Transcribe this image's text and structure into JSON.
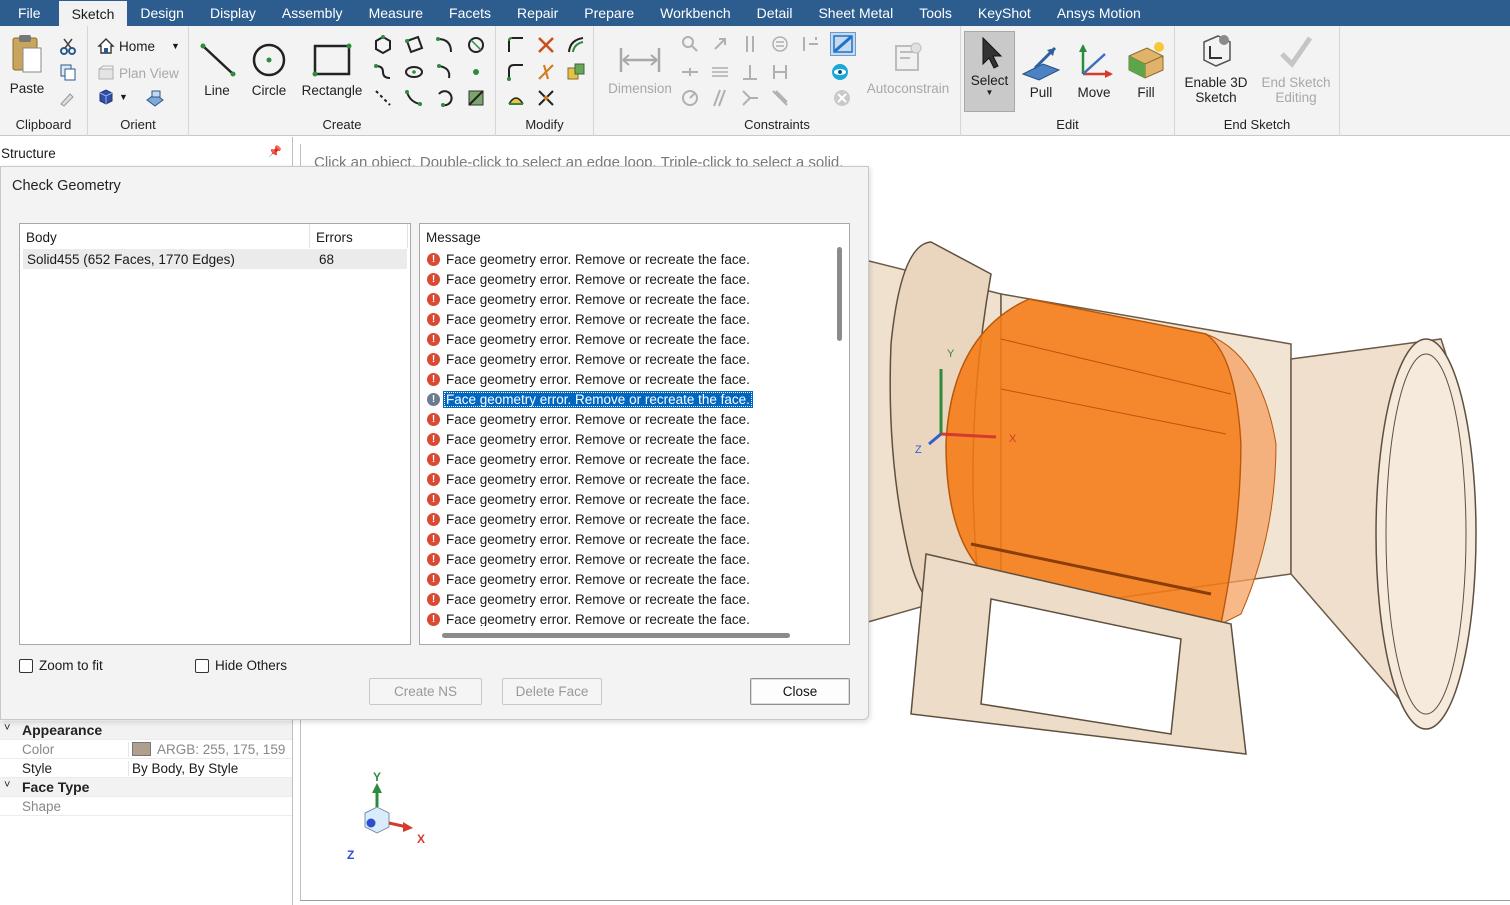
{
  "menu": {
    "tabs": [
      "File",
      "Sketch",
      "Design",
      "Display",
      "Assembly",
      "Measure",
      "Facets",
      "Repair",
      "Prepare",
      "Workbench",
      "Detail",
      "Sheet Metal",
      "Tools",
      "KeyShot",
      "Ansys Motion"
    ],
    "active": "Sketch"
  },
  "ribbon": {
    "clipboard": {
      "label": "Clipboard",
      "paste": "Paste"
    },
    "orient": {
      "label": "Orient",
      "home": "Home",
      "plan_view": "Plan View"
    },
    "create": {
      "label": "Create",
      "line": "Line",
      "circle": "Circle",
      "rectangle": "Rectangle"
    },
    "modify": {
      "label": "Modify"
    },
    "constraints": {
      "label": "Constraints",
      "dimension": "Dimension",
      "autoconstrain": "Autoconstrain"
    },
    "edit": {
      "label": "Edit",
      "select": "Select",
      "pull": "Pull",
      "move": "Move",
      "fill": "Fill"
    },
    "end_sketch": {
      "label": "End Sketch",
      "enable_3d_line1": "Enable 3D",
      "enable_3d_line2": "Sketch",
      "end_edit_line1": "End Sketch",
      "end_edit_line2": "Editing"
    }
  },
  "structure": {
    "title": "Structure"
  },
  "viewport": {
    "hint": "Click an object. Double-click to select an edge loop. Triple-click to select a solid.",
    "triad": {
      "x": "X",
      "y": "Y",
      "z": "Z"
    },
    "model_axes": {
      "x": "X",
      "y": "Y",
      "z": "Z"
    }
  },
  "properties": {
    "appearance": "Appearance",
    "color_label": "Color",
    "color_value": "ARGB: 255, 175, 159",
    "style_label": "Style",
    "style_value": "By Body, By Style",
    "face_type": "Face Type",
    "shape_label": "Shape"
  },
  "dialog": {
    "title": "Check Geometry",
    "body_header": "Body",
    "errors_header": "Errors",
    "body_name": "Solid455 (652 Faces, 1770 Edges)",
    "body_errors": "68",
    "message_header": "Message",
    "messages": [
      "Face geometry error. Remove or recreate the face.",
      "Face geometry error. Remove or recreate the face.",
      "Face geometry error. Remove or recreate the face.",
      "Face geometry error. Remove or recreate the face.",
      "Face geometry error. Remove or recreate the face.",
      "Face geometry error. Remove or recreate the face.",
      "Face geometry error. Remove or recreate the face.",
      "Face geometry error. Remove or recreate the face.",
      "Face geometry error. Remove or recreate the face.",
      "Face geometry error. Remove or recreate the face.",
      "Face geometry error. Remove or recreate the face.",
      "Face geometry error. Remove or recreate the face.",
      "Face geometry error. Remove or recreate the face.",
      "Face geometry error. Remove or recreate the face.",
      "Face geometry error. Remove or recreate the face.",
      "Face geometry error. Remove or recreate the face.",
      "Face geometry error. Remove or recreate the face.",
      "Face geometry error. Remove or recreate the face.",
      "Face geometry error. Remove or recreate the face."
    ],
    "selected_index": 7,
    "zoom_to_fit": "Zoom to fit",
    "hide_others": "Hide Others",
    "create_ns": "Create NS",
    "delete_face": "Delete Face",
    "close": "Close"
  },
  "colors": {
    "menubar": "#2d5d8e",
    "selection": "#0067c0",
    "highlight": "#f57a14",
    "model": "#f3e6d6"
  }
}
